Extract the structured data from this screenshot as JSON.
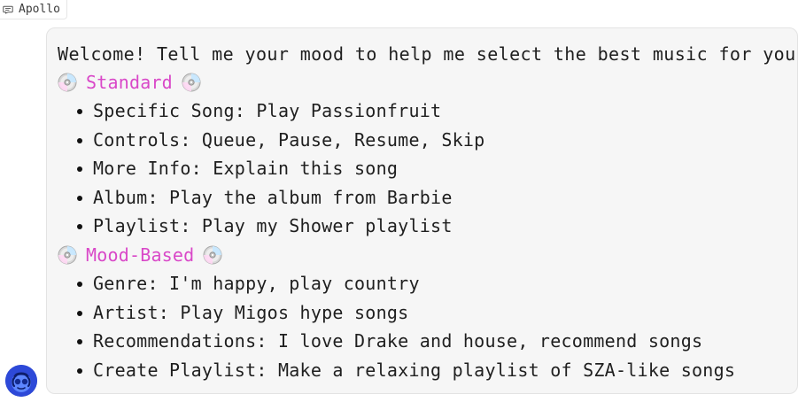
{
  "window": {
    "tab_label": "Apollo"
  },
  "message": {
    "welcome": "Welcome! Tell me your mood to help me select the best music for you",
    "sections": [
      {
        "title": "Standard",
        "items": [
          "Specific Song: Play Passionfruit",
          "Controls: Queue, Pause, Resume, Skip",
          "More Info: Explain this song",
          "Album: Play the album from Barbie",
          "Playlist: Play my Shower playlist"
        ]
      },
      {
        "title": "Mood-Based",
        "items": [
          "Genre: I'm happy, play country",
          "Artist: Play Migos hype songs",
          "Recommendations: I love Drake and house, recommend songs",
          "Create Playlist: Make a relaxing playlist of SZA-like songs"
        ]
      }
    ]
  },
  "icons": {
    "tag": "chat-bubble-icon",
    "section_marker": "cd-disc-icon",
    "avatar": "apollo-avatar-icon"
  },
  "colors": {
    "section_heading": "#d948c8",
    "card_background": "#f6f6f6",
    "card_border": "#e3e3e3",
    "avatar_blue": "#2d49d8"
  }
}
